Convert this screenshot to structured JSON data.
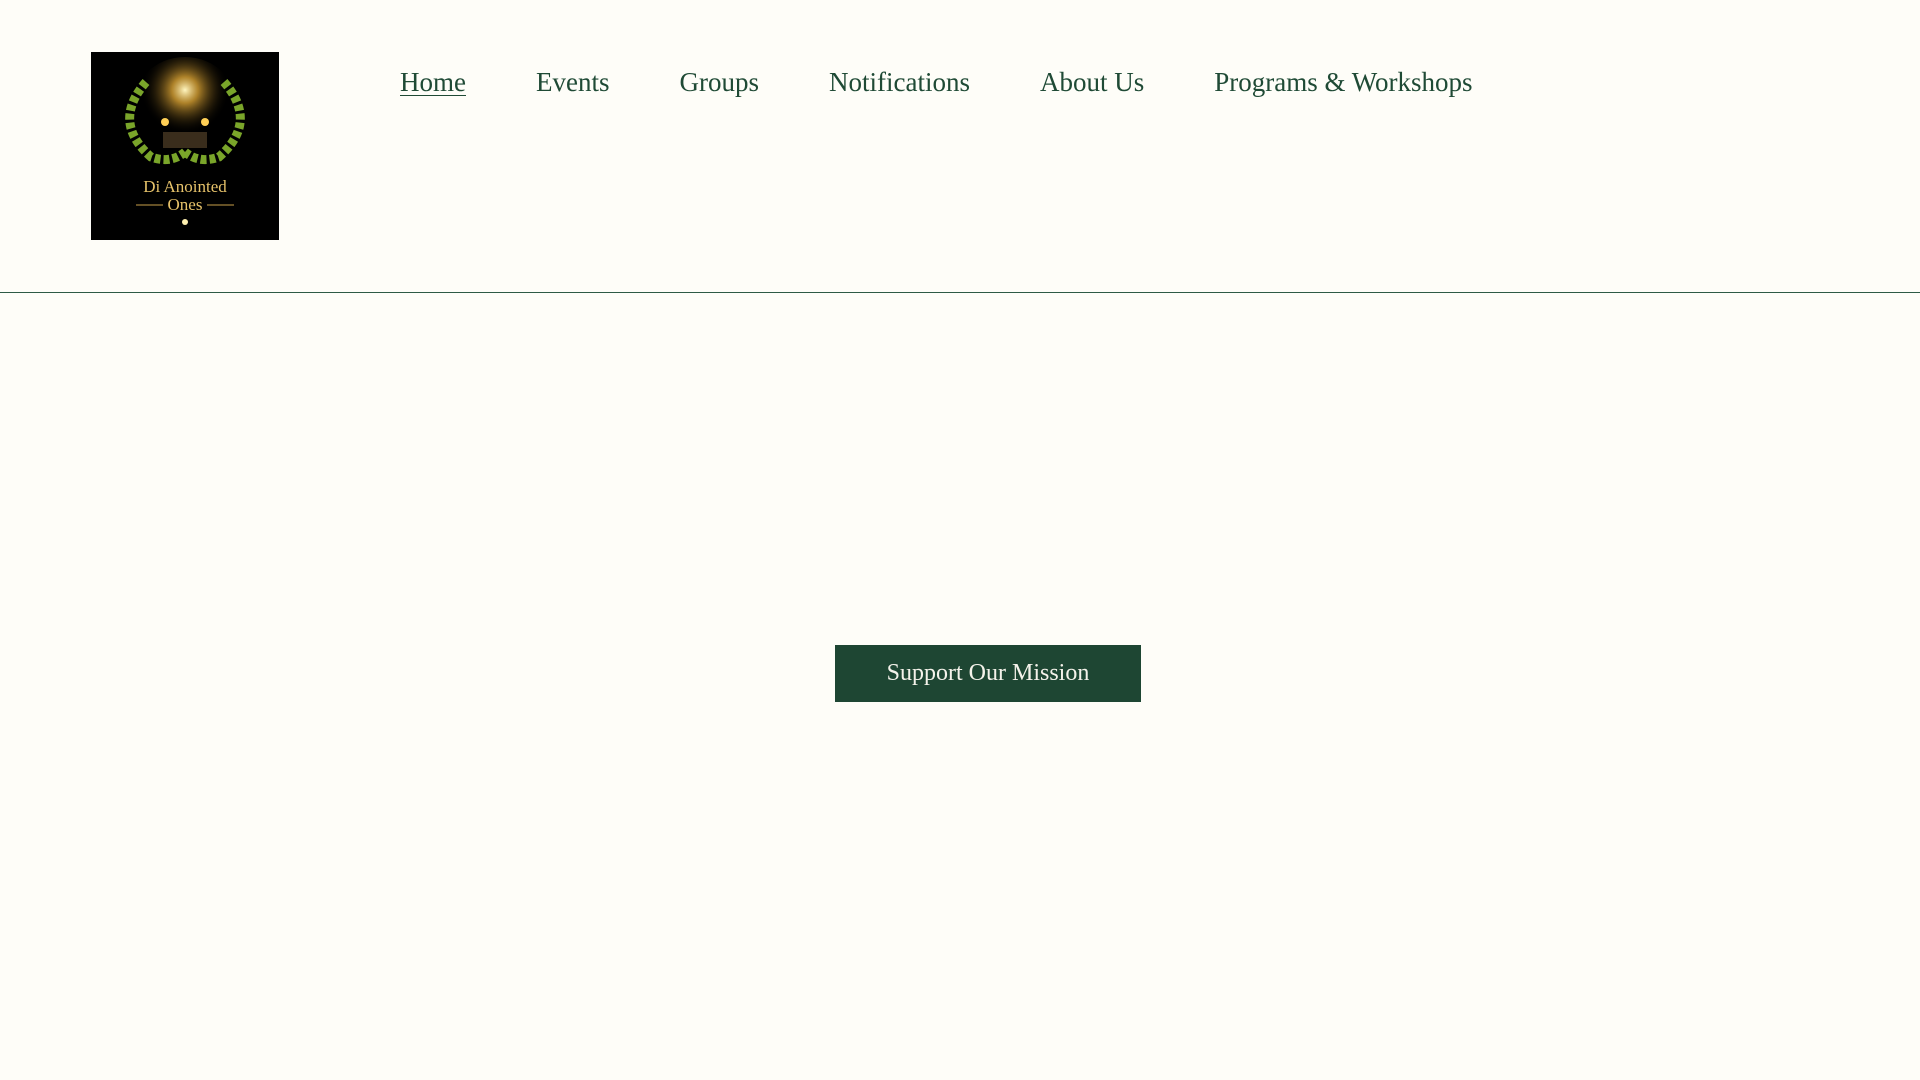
{
  "brand": {
    "logo_text": "Di Anointed Ones"
  },
  "nav": {
    "items": [
      {
        "label": "Home",
        "active": true
      },
      {
        "label": "Events"
      },
      {
        "label": "Groups"
      },
      {
        "label": "Notifications"
      },
      {
        "label": "About Us"
      },
      {
        "label": "Programs & Workshops"
      }
    ]
  },
  "hero": {
    "cta_label": "Support Our Mission"
  },
  "colors": {
    "background": "#fefdf8",
    "accent": "#1e4633",
    "nav_text": "#1f4a35"
  }
}
